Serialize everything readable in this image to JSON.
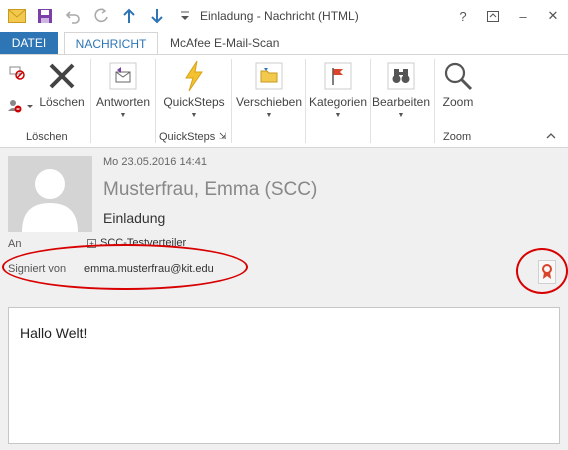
{
  "window": {
    "title": "Einladung - Nachricht (HTML)",
    "help": "?",
    "minimize": "–",
    "close": "✕"
  },
  "tabs": [
    {
      "label": "DATEI"
    },
    {
      "label": "NACHRICHT"
    },
    {
      "label": "McAfee E-Mail-Scan"
    }
  ],
  "ribbon": {
    "delete_label": "Löschen",
    "reply_label": "Antworten",
    "quicksteps_label": "QuickSteps",
    "move_label": "Verschieben",
    "categories_label": "Kategorien",
    "edit_label": "Bearbeiten",
    "zoom_label": "Zoom",
    "groups": {
      "delete": "Löschen",
      "quicksteps": "QuickSteps",
      "zoom": "Zoom"
    }
  },
  "message": {
    "date": "Mo 23.05.2016 14:41",
    "sender": "Musterfrau, Emma (SCC)",
    "subject": "Einladung",
    "to_label": "An",
    "to_value": "SCC-Testverteiler",
    "signed_label": "Signiert von",
    "signed_value": "emma.musterfrau@kit.edu",
    "body": "Hallo Welt!"
  },
  "colors": {
    "accent": "#2e75b6",
    "annotation": "#d80000"
  }
}
